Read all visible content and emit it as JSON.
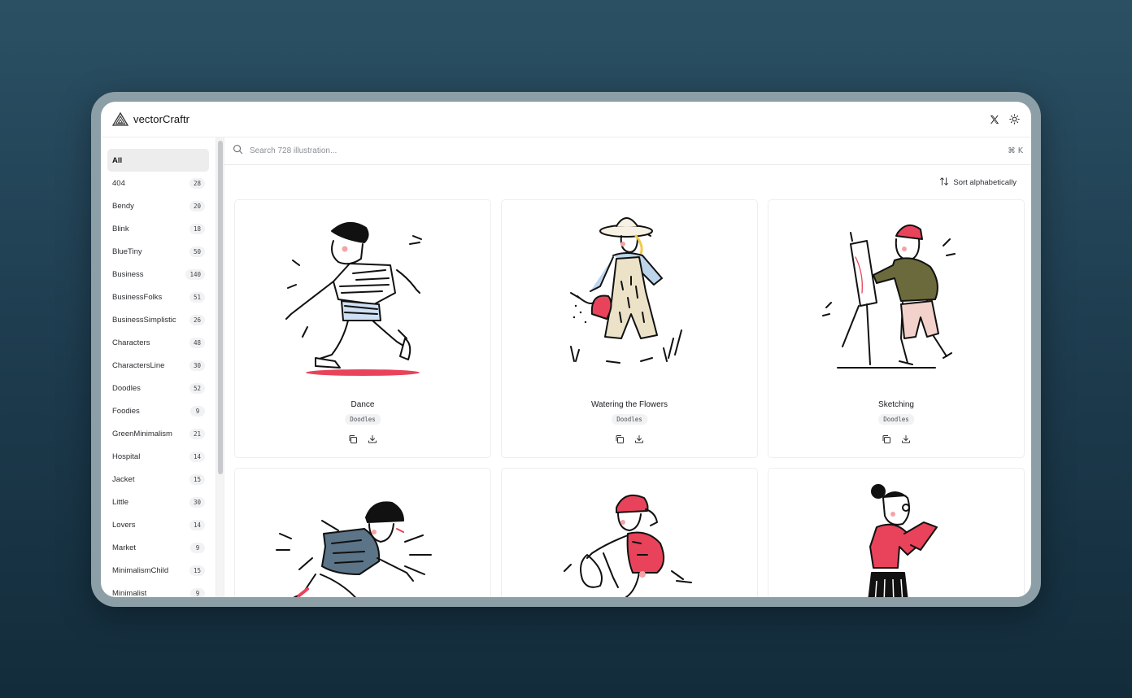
{
  "header": {
    "brand": "vectorCraftr",
    "logo_icon": "triangle-logo-icon",
    "actions": [
      {
        "icon": "x-twitter-icon"
      },
      {
        "icon": "sun-icon"
      }
    ]
  },
  "sidebar": {
    "items": [
      {
        "label": "All",
        "count": null,
        "active": true
      },
      {
        "label": "404",
        "count": "28"
      },
      {
        "label": "Bendy",
        "count": "20"
      },
      {
        "label": "Blink",
        "count": "18"
      },
      {
        "label": "BlueTiny",
        "count": "50"
      },
      {
        "label": "Business",
        "count": "140"
      },
      {
        "label": "BusinessFolks",
        "count": "51"
      },
      {
        "label": "BusinessSimplistic",
        "count": "26"
      },
      {
        "label": "Characters",
        "count": "48"
      },
      {
        "label": "CharactersLine",
        "count": "30"
      },
      {
        "label": "Doodles",
        "count": "52"
      },
      {
        "label": "Foodies",
        "count": "9"
      },
      {
        "label": "GreenMinimalism",
        "count": "21"
      },
      {
        "label": "Hospital",
        "count": "14"
      },
      {
        "label": "Jacket",
        "count": "15"
      },
      {
        "label": "Little",
        "count": "30"
      },
      {
        "label": "Lovers",
        "count": "14"
      },
      {
        "label": "Market",
        "count": "9"
      },
      {
        "label": "MinimalismChild",
        "count": "15"
      },
      {
        "label": "Minimalist",
        "count": "9"
      }
    ]
  },
  "search": {
    "placeholder": "Search 728 illustration...",
    "value": "",
    "shortcut": "⌘ K",
    "icon": "search-icon"
  },
  "sort": {
    "label": "Sort alphabetically",
    "icon": "sort-arrows-icon"
  },
  "cards": [
    {
      "title": "Dance",
      "tag": "Doodles",
      "illustration": "dancing-person"
    },
    {
      "title": "Watering the Flowers",
      "tag": "Doodles",
      "illustration": "gardener-watering"
    },
    {
      "title": "Sketching",
      "tag": "Doodles",
      "illustration": "painter-at-easel"
    },
    {
      "title": "",
      "tag": "",
      "illustration": "running-kid-beanie"
    },
    {
      "title": "",
      "tag": "",
      "illustration": "cyclist-helmet"
    },
    {
      "title": "",
      "tag": "",
      "illustration": "woman-reading-book"
    }
  ],
  "colors": {
    "accent_pink": "#e8435a",
    "background_top": "#2b5064",
    "background_bottom": "#132c3b"
  }
}
